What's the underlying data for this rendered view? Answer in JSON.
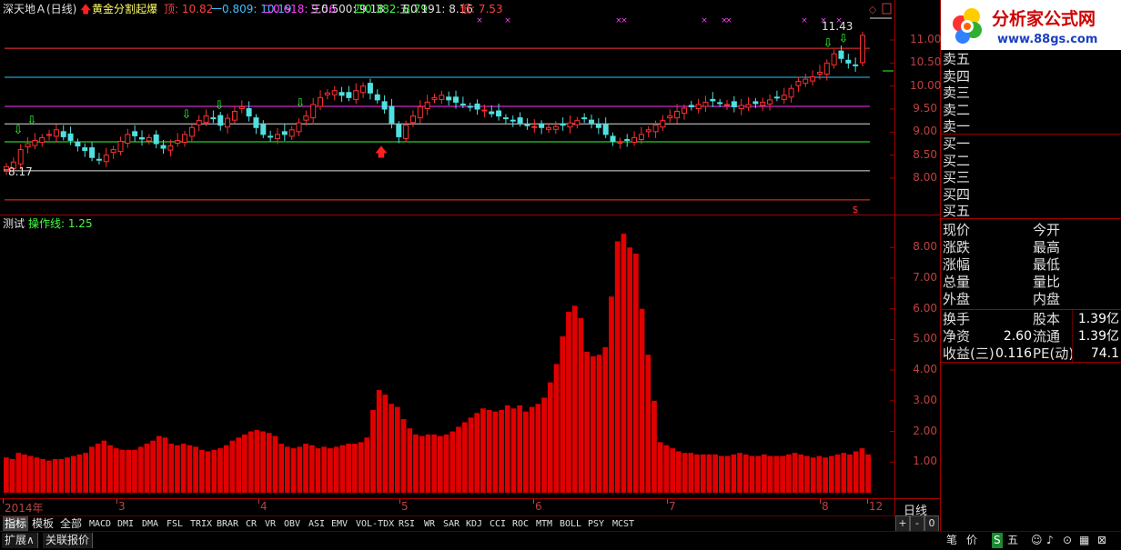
{
  "header": {
    "stock_title": "深天地Ａ(日线)",
    "formula_name": "黄金分割起爆",
    "levels": {
      "top": "顶: 10.82",
      "l1": "一0.809: 10.19",
      "l2": "二0.618: 9.56",
      "l3": "三0.500: 9.18",
      "l4": "四0.382: 8.79",
      "l5": "五0.191: 8.16",
      "low": "低: 7.53"
    }
  },
  "main_chart": {
    "y_ticks": [
      "11.00",
      "10.50",
      "10.00",
      "9.50",
      "9.00",
      "8.50",
      "8.00"
    ],
    "hi_label": "11.43",
    "lo_label": "8.17",
    "fib_lines": [
      {
        "value": 10.82,
        "color": "#ff3030"
      },
      {
        "value": 10.19,
        "color": "#30c0ff"
      },
      {
        "value": 9.56,
        "color": "#ff30ff"
      },
      {
        "value": 9.18,
        "color": "#e0e0e0"
      },
      {
        "value": 8.79,
        "color": "#30ff30"
      },
      {
        "value": 8.16,
        "color": "#e0e0e0"
      },
      {
        "value": 7.53,
        "color": "#ff3030"
      }
    ]
  },
  "indicator": {
    "title": "测试",
    "op_line": "操作线: 1.25",
    "y_ticks": [
      "8.00",
      "7.00",
      "6.00",
      "5.00",
      "4.00",
      "3.00",
      "2.00",
      "1.00"
    ]
  },
  "chart_data": {
    "type": "bar",
    "title": "操作线",
    "ylim": [
      0,
      9
    ],
    "values": [
      1.15,
      1.1,
      1.3,
      1.25,
      1.2,
      1.15,
      1.1,
      1.05,
      1.1,
      1.1,
      1.15,
      1.2,
      1.25,
      1.3,
      1.5,
      1.6,
      1.7,
      1.55,
      1.45,
      1.4,
      1.4,
      1.4,
      1.5,
      1.6,
      1.7,
      1.85,
      1.8,
      1.6,
      1.55,
      1.6,
      1.55,
      1.5,
      1.4,
      1.35,
      1.4,
      1.45,
      1.55,
      1.7,
      1.8,
      1.9,
      2.0,
      2.05,
      2.0,
      1.95,
      1.85,
      1.6,
      1.5,
      1.45,
      1.5,
      1.6,
      1.55,
      1.45,
      1.5,
      1.45,
      1.5,
      1.55,
      1.6,
      1.6,
      1.65,
      1.8,
      2.7,
      3.35,
      3.2,
      2.9,
      2.8,
      2.4,
      2.1,
      1.9,
      1.85,
      1.9,
      1.9,
      1.85,
      1.9,
      2.0,
      2.15,
      2.3,
      2.45,
      2.6,
      2.75,
      2.7,
      2.65,
      2.7,
      2.85,
      2.75,
      2.85,
      2.65,
      2.8,
      2.9,
      3.1,
      3.6,
      4.2,
      5.1,
      5.9,
      6.1,
      5.7,
      4.6,
      4.45,
      4.5,
      4.75,
      6.4,
      8.2,
      8.45,
      8.0,
      7.8,
      6.0,
      4.5,
      3.0,
      1.65,
      1.55,
      1.45,
      1.35,
      1.3,
      1.3,
      1.25,
      1.25,
      1.25,
      1.25,
      1.2,
      1.2,
      1.25,
      1.3,
      1.25,
      1.2,
      1.2,
      1.25,
      1.2,
      1.2,
      1.2,
      1.25,
      1.3,
      1.25,
      1.2,
      1.15,
      1.2,
      1.15,
      1.2,
      1.25,
      1.3,
      1.25,
      1.35,
      1.45,
      1.25
    ]
  },
  "date_axis": [
    "2014年",
    "3",
    "4",
    "5",
    "6",
    "7",
    "8",
    "12"
  ],
  "tabs": [
    "指标",
    "模板",
    "全部",
    "MACD",
    "DMI",
    "DMA",
    "FSL",
    "TRIX",
    "BRAR",
    "CR",
    "VR",
    "OBV",
    "ASI",
    "EMV",
    "VOL-TDX",
    "RSI",
    "WR",
    "SAR",
    "KDJ",
    "CCI",
    "ROC",
    "MTM",
    "BOLL",
    "PSY",
    "MCST"
  ],
  "bottom_buttons": [
    "扩展∧",
    "关联报价"
  ],
  "zoom": [
    "+",
    "-",
    "0"
  ],
  "period": "日线",
  "right_panel": {
    "logo_text": "分析家公式网",
    "logo_url": "www.88gs.com",
    "sell": [
      "卖五",
      "卖四",
      "卖三",
      "卖二",
      "卖一"
    ],
    "buy": [
      "买一",
      "买二",
      "买三",
      "买四",
      "买五"
    ],
    "quote_left": [
      "现价",
      "涨跌",
      "涨幅",
      "总量",
      "外盘"
    ],
    "quote_right": [
      "今开",
      "最高",
      "最低",
      "量比",
      "内盘"
    ],
    "extra": [
      {
        "l": "换手",
        "v": "",
        "r": "股本",
        "rv": "1.39亿"
      },
      {
        "l": "净资",
        "v": "2.60",
        "r": "流通",
        "rv": "1.39亿"
      },
      {
        "l": "收益(三)",
        "v": "0.116",
        "r": "PE(动)",
        "rv": "74.1"
      }
    ],
    "bottom_icons": [
      "笔",
      "价",
      "S",
      "五",
      "☺",
      "♪",
      "⊙",
      "▦",
      "⊠"
    ]
  }
}
